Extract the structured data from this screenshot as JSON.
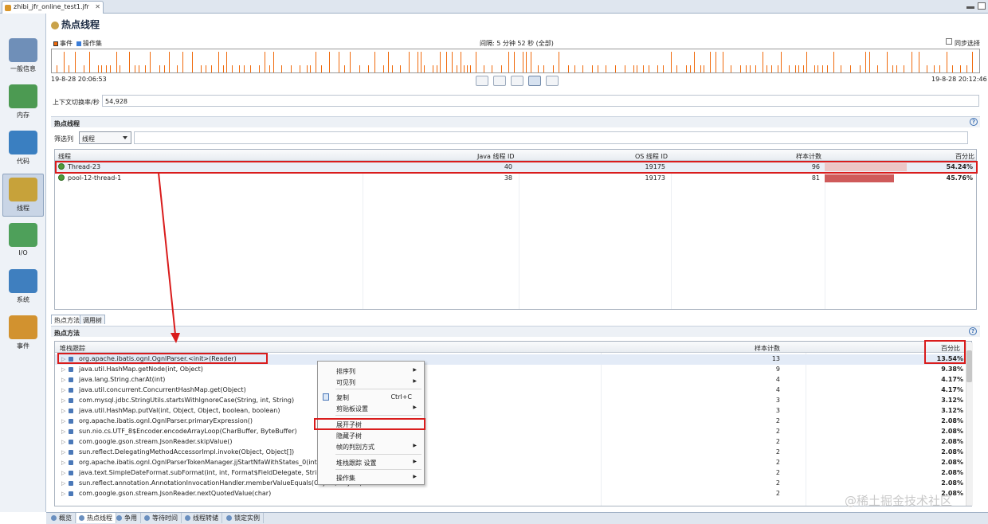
{
  "window": {
    "tab_title": "zhibi_jfr_online_test1.jfr",
    "close_glyph": "✕"
  },
  "nav": {
    "items": [
      {
        "label": "一般信息",
        "icon": "gauge-icon"
      },
      {
        "label": "内存",
        "icon": "memory-icon"
      },
      {
        "label": "代码",
        "icon": "code-icon"
      },
      {
        "label": "线程",
        "icon": "threads-icon",
        "selected": true
      },
      {
        "label": "I/O",
        "icon": "io-icon"
      },
      {
        "label": "系统",
        "icon": "system-icon"
      },
      {
        "label": "事件",
        "icon": "events-icon"
      }
    ]
  },
  "page": {
    "title": "热点线程"
  },
  "timeline": {
    "legend_events": "事件",
    "legend_opset": "操作集",
    "interval": "间隔: 5 分钟 52 秒 (全部)",
    "sync_select": "同步选择",
    "start": "19-8-28 20:06:53",
    "end": "19-8-28 20:12:46",
    "colors": {
      "events": "#f06a0c",
      "opset": "#3b7dd8"
    }
  },
  "context_switch": {
    "label": "上下文切换率/秒",
    "value": "54,928"
  },
  "hot_threads": {
    "section_title": "热点线程",
    "filter_label": "筛选列",
    "filter_value": "线程",
    "columns": [
      "线程",
      "Java 线程 ID",
      "OS 线程 ID",
      "样本计数",
      "百分比"
    ],
    "rows": [
      {
        "name": "Thread-23",
        "java_id": "40",
        "os_id": "19175",
        "samples": "96",
        "percent": "54.24%",
        "fraction": 0.5424
      },
      {
        "name": "pool-12-thread-1",
        "java_id": "38",
        "os_id": "19173",
        "samples": "81",
        "percent": "45.76%",
        "fraction": 0.4576
      }
    ]
  },
  "subtabs": [
    "热点方法",
    "调用树"
  ],
  "hot_methods": {
    "section_title": "热点方法",
    "columns": [
      "堆栈跟踪",
      "样本计数",
      "百分比"
    ],
    "rows": [
      {
        "name": "org.apache.ibatis.ognl.OgnlParser.<init>(Reader)",
        "count": "13",
        "percent": "13.54%"
      },
      {
        "name": "java.util.HashMap.getNode(int, Object)",
        "count": "9",
        "percent": "9.38%"
      },
      {
        "name": "java.lang.String.charAt(int)",
        "count": "4",
        "percent": "4.17%"
      },
      {
        "name": "java.util.concurrent.ConcurrentHashMap.get(Object)",
        "count": "4",
        "percent": "4.17%"
      },
      {
        "name": "com.mysql.jdbc.StringUtils.startsWithIgnoreCase(String, int, String)",
        "count": "3",
        "percent": "3.12%"
      },
      {
        "name": "java.util.HashMap.putVal(int, Object, Object, boolean, boolean)",
        "count": "3",
        "percent": "3.12%"
      },
      {
        "name": "org.apache.ibatis.ognl.OgnlParser.primaryExpression()",
        "count": "2",
        "percent": "2.08%"
      },
      {
        "name": "sun.nio.cs.UTF_8$Encoder.encodeArrayLoop(CharBuffer, ByteBuffer)",
        "count": "2",
        "percent": "2.08%"
      },
      {
        "name": "com.google.gson.stream.JsonReader.skipValue()",
        "count": "2",
        "percent": "2.08%"
      },
      {
        "name": "sun.reflect.DelegatingMethodAccessorImpl.invoke(Object, Object[])",
        "count": "2",
        "percent": "2.08%"
      },
      {
        "name": "org.apache.ibatis.ognl.OgnlParserTokenManager.jjStartNfaWithStates_0(int, int",
        "count": "2",
        "percent": "2.08%"
      },
      {
        "name": "java.text.SimpleDateFormat.subFormat(int, int, Format$FieldDelegate, StringBuf",
        "count": "2",
        "percent": "2.08%"
      },
      {
        "name": "sun.reflect.annotation.AnnotationInvocationHandler.memberValueEquals(Object, Object)",
        "count": "2",
        "percent": "2.08%"
      },
      {
        "name": "com.google.gson.stream.JsonReader.nextQuotedValue(char)",
        "count": "2",
        "percent": "2.08%"
      }
    ]
  },
  "context_menu": {
    "items": [
      {
        "label": "排序列",
        "submenu": true
      },
      {
        "label": "可见列",
        "submenu": true
      },
      {
        "label": "复制",
        "shortcut": "Ctrl+C"
      },
      {
        "label": "剪贴板设置",
        "submenu": true
      },
      {
        "label": "展开子树"
      },
      {
        "label": "隐藏子树"
      },
      {
        "label": "帧的判别方式",
        "submenu": true
      },
      {
        "label": "堆栈跟踪 设置",
        "submenu": true
      },
      {
        "label": "操作集",
        "submenu": true
      }
    ]
  },
  "bottom_tabs": [
    "概览",
    "热点线程",
    "争用",
    "等待时间",
    "线程转储",
    "锁定实例"
  ],
  "watermark": "@稀土掘金技术社区",
  "highlight_color": "#d91c1c"
}
